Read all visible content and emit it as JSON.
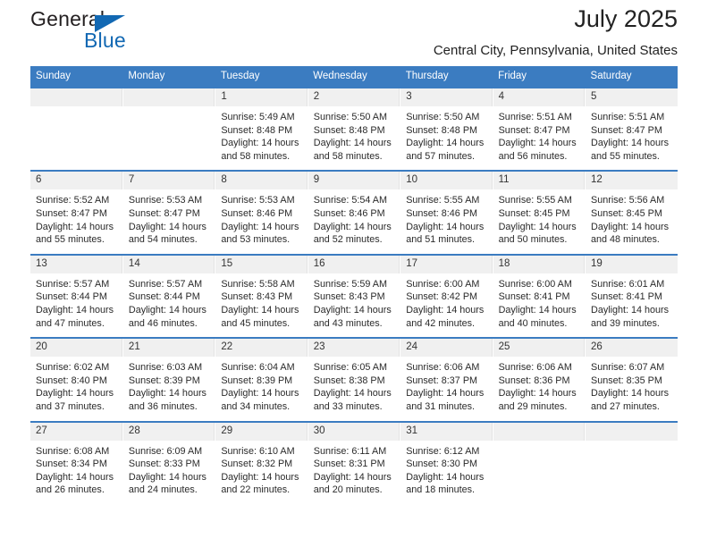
{
  "brand": {
    "line1": "General",
    "line2": "Blue",
    "accent_color": "#1268b3"
  },
  "header": {
    "title": "July 2025",
    "subtitle": "Central City, Pennsylvania, United States",
    "header_bg_color": "#3b7cc1",
    "daynum_bg_color": "#f0f0f0"
  },
  "weekday_headers": [
    "Sunday",
    "Monday",
    "Tuesday",
    "Wednesday",
    "Thursday",
    "Friday",
    "Saturday"
  ],
  "labels": {
    "sunrise_prefix": "Sunrise:",
    "sunset_prefix": "Sunset:",
    "daylight_prefix": "Daylight:"
  },
  "weeks": [
    [
      {
        "day": "",
        "empty": true
      },
      {
        "day": "",
        "empty": true
      },
      {
        "day": "1",
        "sunrise": "Sunrise: 5:49 AM",
        "sunset": "Sunset: 8:48 PM",
        "daylight_line1": "Daylight: 14 hours",
        "daylight_line2": "and 58 minutes."
      },
      {
        "day": "2",
        "sunrise": "Sunrise: 5:50 AM",
        "sunset": "Sunset: 8:48 PM",
        "daylight_line1": "Daylight: 14 hours",
        "daylight_line2": "and 58 minutes."
      },
      {
        "day": "3",
        "sunrise": "Sunrise: 5:50 AM",
        "sunset": "Sunset: 8:48 PM",
        "daylight_line1": "Daylight: 14 hours",
        "daylight_line2": "and 57 minutes."
      },
      {
        "day": "4",
        "sunrise": "Sunrise: 5:51 AM",
        "sunset": "Sunset: 8:47 PM",
        "daylight_line1": "Daylight: 14 hours",
        "daylight_line2": "and 56 minutes."
      },
      {
        "day": "5",
        "sunrise": "Sunrise: 5:51 AM",
        "sunset": "Sunset: 8:47 PM",
        "daylight_line1": "Daylight: 14 hours",
        "daylight_line2": "and 55 minutes."
      }
    ],
    [
      {
        "day": "6",
        "sunrise": "Sunrise: 5:52 AM",
        "sunset": "Sunset: 8:47 PM",
        "daylight_line1": "Daylight: 14 hours",
        "daylight_line2": "and 55 minutes."
      },
      {
        "day": "7",
        "sunrise": "Sunrise: 5:53 AM",
        "sunset": "Sunset: 8:47 PM",
        "daylight_line1": "Daylight: 14 hours",
        "daylight_line2": "and 54 minutes."
      },
      {
        "day": "8",
        "sunrise": "Sunrise: 5:53 AM",
        "sunset": "Sunset: 8:46 PM",
        "daylight_line1": "Daylight: 14 hours",
        "daylight_line2": "and 53 minutes."
      },
      {
        "day": "9",
        "sunrise": "Sunrise: 5:54 AM",
        "sunset": "Sunset: 8:46 PM",
        "daylight_line1": "Daylight: 14 hours",
        "daylight_line2": "and 52 minutes."
      },
      {
        "day": "10",
        "sunrise": "Sunrise: 5:55 AM",
        "sunset": "Sunset: 8:46 PM",
        "daylight_line1": "Daylight: 14 hours",
        "daylight_line2": "and 51 minutes."
      },
      {
        "day": "11",
        "sunrise": "Sunrise: 5:55 AM",
        "sunset": "Sunset: 8:45 PM",
        "daylight_line1": "Daylight: 14 hours",
        "daylight_line2": "and 50 minutes."
      },
      {
        "day": "12",
        "sunrise": "Sunrise: 5:56 AM",
        "sunset": "Sunset: 8:45 PM",
        "daylight_line1": "Daylight: 14 hours",
        "daylight_line2": "and 48 minutes."
      }
    ],
    [
      {
        "day": "13",
        "sunrise": "Sunrise: 5:57 AM",
        "sunset": "Sunset: 8:44 PM",
        "daylight_line1": "Daylight: 14 hours",
        "daylight_line2": "and 47 minutes."
      },
      {
        "day": "14",
        "sunrise": "Sunrise: 5:57 AM",
        "sunset": "Sunset: 8:44 PM",
        "daylight_line1": "Daylight: 14 hours",
        "daylight_line2": "and 46 minutes."
      },
      {
        "day": "15",
        "sunrise": "Sunrise: 5:58 AM",
        "sunset": "Sunset: 8:43 PM",
        "daylight_line1": "Daylight: 14 hours",
        "daylight_line2": "and 45 minutes."
      },
      {
        "day": "16",
        "sunrise": "Sunrise: 5:59 AM",
        "sunset": "Sunset: 8:43 PM",
        "daylight_line1": "Daylight: 14 hours",
        "daylight_line2": "and 43 minutes."
      },
      {
        "day": "17",
        "sunrise": "Sunrise: 6:00 AM",
        "sunset": "Sunset: 8:42 PM",
        "daylight_line1": "Daylight: 14 hours",
        "daylight_line2": "and 42 minutes."
      },
      {
        "day": "18",
        "sunrise": "Sunrise: 6:00 AM",
        "sunset": "Sunset: 8:41 PM",
        "daylight_line1": "Daylight: 14 hours",
        "daylight_line2": "and 40 minutes."
      },
      {
        "day": "19",
        "sunrise": "Sunrise: 6:01 AM",
        "sunset": "Sunset: 8:41 PM",
        "daylight_line1": "Daylight: 14 hours",
        "daylight_line2": "and 39 minutes."
      }
    ],
    [
      {
        "day": "20",
        "sunrise": "Sunrise: 6:02 AM",
        "sunset": "Sunset: 8:40 PM",
        "daylight_line1": "Daylight: 14 hours",
        "daylight_line2": "and 37 minutes."
      },
      {
        "day": "21",
        "sunrise": "Sunrise: 6:03 AM",
        "sunset": "Sunset: 8:39 PM",
        "daylight_line1": "Daylight: 14 hours",
        "daylight_line2": "and 36 minutes."
      },
      {
        "day": "22",
        "sunrise": "Sunrise: 6:04 AM",
        "sunset": "Sunset: 8:39 PM",
        "daylight_line1": "Daylight: 14 hours",
        "daylight_line2": "and 34 minutes."
      },
      {
        "day": "23",
        "sunrise": "Sunrise: 6:05 AM",
        "sunset": "Sunset: 8:38 PM",
        "daylight_line1": "Daylight: 14 hours",
        "daylight_line2": "and 33 minutes."
      },
      {
        "day": "24",
        "sunrise": "Sunrise: 6:06 AM",
        "sunset": "Sunset: 8:37 PM",
        "daylight_line1": "Daylight: 14 hours",
        "daylight_line2": "and 31 minutes."
      },
      {
        "day": "25",
        "sunrise": "Sunrise: 6:06 AM",
        "sunset": "Sunset: 8:36 PM",
        "daylight_line1": "Daylight: 14 hours",
        "daylight_line2": "and 29 minutes."
      },
      {
        "day": "26",
        "sunrise": "Sunrise: 6:07 AM",
        "sunset": "Sunset: 8:35 PM",
        "daylight_line1": "Daylight: 14 hours",
        "daylight_line2": "and 27 minutes."
      }
    ],
    [
      {
        "day": "27",
        "sunrise": "Sunrise: 6:08 AM",
        "sunset": "Sunset: 8:34 PM",
        "daylight_line1": "Daylight: 14 hours",
        "daylight_line2": "and 26 minutes."
      },
      {
        "day": "28",
        "sunrise": "Sunrise: 6:09 AM",
        "sunset": "Sunset: 8:33 PM",
        "daylight_line1": "Daylight: 14 hours",
        "daylight_line2": "and 24 minutes."
      },
      {
        "day": "29",
        "sunrise": "Sunrise: 6:10 AM",
        "sunset": "Sunset: 8:32 PM",
        "daylight_line1": "Daylight: 14 hours",
        "daylight_line2": "and 22 minutes."
      },
      {
        "day": "30",
        "sunrise": "Sunrise: 6:11 AM",
        "sunset": "Sunset: 8:31 PM",
        "daylight_line1": "Daylight: 14 hours",
        "daylight_line2": "and 20 minutes."
      },
      {
        "day": "31",
        "sunrise": "Sunrise: 6:12 AM",
        "sunset": "Sunset: 8:30 PM",
        "daylight_line1": "Daylight: 14 hours",
        "daylight_line2": "and 18 minutes."
      },
      {
        "day": "",
        "empty": true
      },
      {
        "day": "",
        "empty": true
      }
    ]
  ]
}
